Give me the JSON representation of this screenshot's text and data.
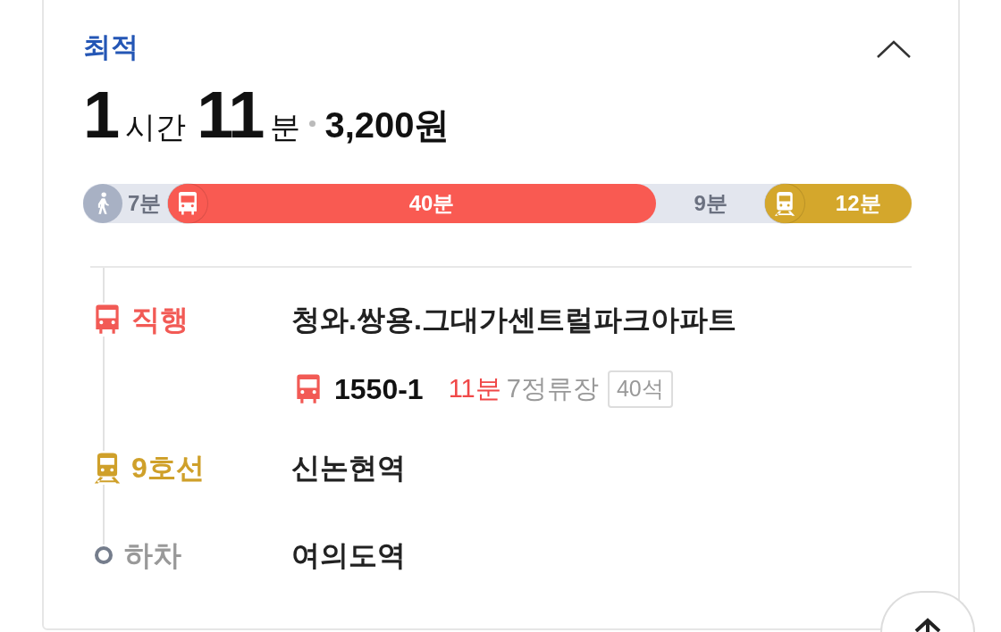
{
  "label": "최적",
  "expanded": true,
  "duration": {
    "hours": "1",
    "hours_unit": "시간",
    "minutes": "11",
    "minutes_unit": "분"
  },
  "fare": "3,200원",
  "timeline": [
    {
      "kind": "walk",
      "minutes": "7분"
    },
    {
      "kind": "bus",
      "minutes": "40분",
      "color": "#f95a52"
    },
    {
      "kind": "wait",
      "minutes": "9분"
    },
    {
      "kind": "subway",
      "minutes": "12분",
      "color": "#d4a72c"
    }
  ],
  "steps": [
    {
      "kind": "bus",
      "label": "직행",
      "color": "#f25a55",
      "stop": "청와.쌍용.그대가센트럴파크아파트",
      "route": {
        "number": "1550-1",
        "eta": "11분",
        "stops": "7정류장",
        "seats": "40석"
      }
    },
    {
      "kind": "subway",
      "label": "9호선",
      "color": "#cfa02a",
      "stop": "신논현역"
    },
    {
      "kind": "alight",
      "label": "하차",
      "stop": "여의도역"
    }
  ]
}
